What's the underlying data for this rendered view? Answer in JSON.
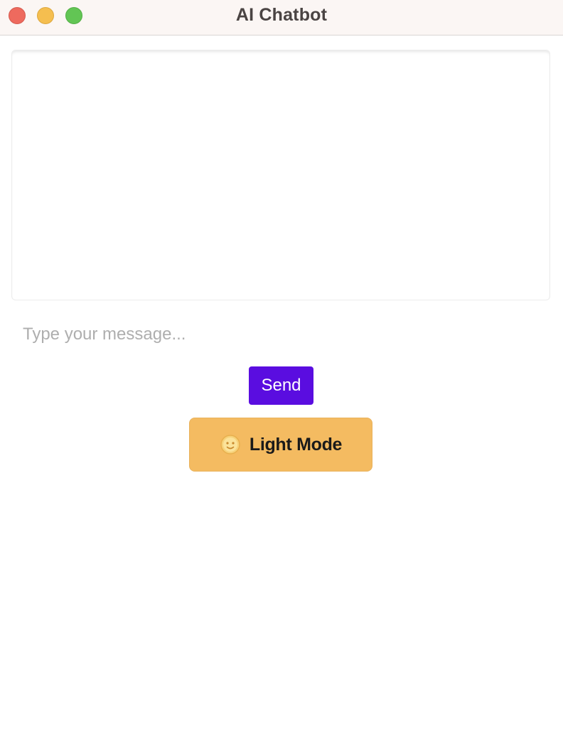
{
  "window": {
    "title": "AI Chatbot"
  },
  "chat": {
    "messages": []
  },
  "input": {
    "value": "",
    "placeholder": "Type your message..."
  },
  "send_button": {
    "label": "Send",
    "color": "#5a0de0"
  },
  "theme_toggle": {
    "label": "Light Mode",
    "icon": "sun-face-icon",
    "color": "#f4bb61"
  }
}
